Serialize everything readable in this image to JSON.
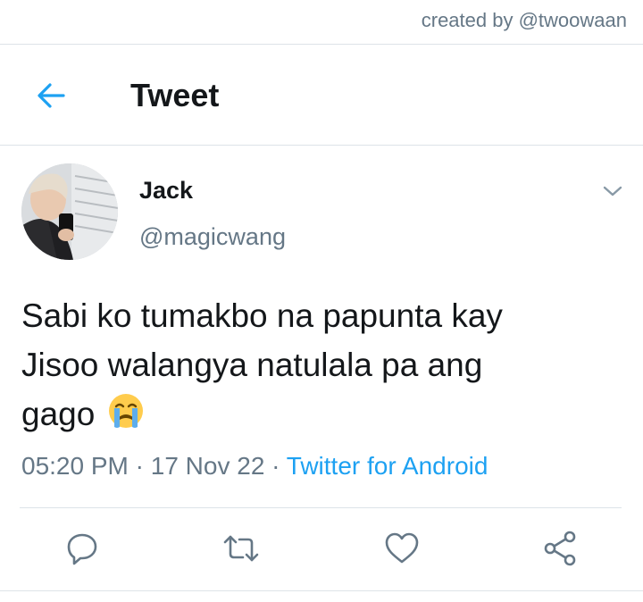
{
  "watermark": "created by @twoowaan",
  "header": {
    "title": "Tweet",
    "back_icon": "arrow-left-icon"
  },
  "tweet": {
    "author": {
      "name": "Jack",
      "handle": "@magicwang"
    },
    "text_lines": [
      "Sabi ko tumakbo na papunta kay",
      "Jisoo walangya natulala pa ang",
      "gago"
    ],
    "emoji": "loudly-crying-face",
    "time": "05:20 PM",
    "date": "17 Nov 22",
    "separator": "·",
    "source": "Twitter for Android"
  },
  "actions": [
    "reply-icon",
    "retweet-icon",
    "like-icon",
    "share-icon"
  ],
  "colors": {
    "accent": "#1da1f2",
    "secondary_text": "#657786",
    "divider": "#dde3e8"
  }
}
